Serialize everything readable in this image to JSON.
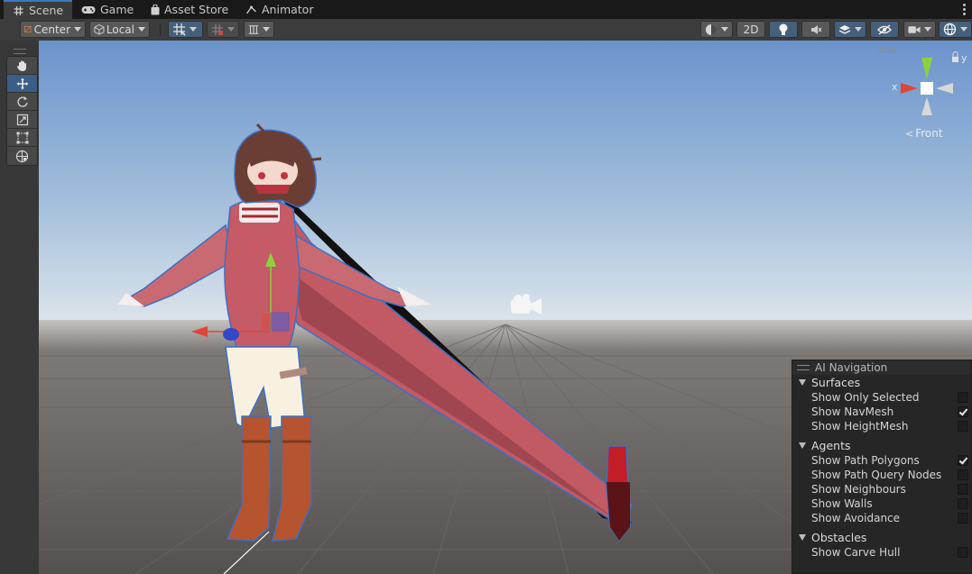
{
  "tabs": [
    {
      "label": "Scene",
      "icon": "grid-icon",
      "active": true
    },
    {
      "label": "Game",
      "icon": "gamepad-icon",
      "active": false
    },
    {
      "label": "Asset Store",
      "icon": "shopping-bag-icon",
      "active": false
    },
    {
      "label": "Animator",
      "icon": "animator-icon",
      "active": false
    }
  ],
  "toolbar": {
    "pivot_mode": "Center",
    "pivot_rotation": "Local",
    "mode_2d": "2D"
  },
  "gizmo": {
    "x_label": "x",
    "y_label": "y",
    "view_label": "Front"
  },
  "ai_navigation": {
    "title": "AI Navigation",
    "sections": [
      {
        "name": "Surfaces",
        "options": [
          {
            "label": "Show Only Selected",
            "checked": false
          },
          {
            "label": "Show NavMesh",
            "checked": true
          },
          {
            "label": "Show HeightMesh",
            "checked": false
          }
        ]
      },
      {
        "name": "Agents",
        "options": [
          {
            "label": "Show Path Polygons",
            "checked": true
          },
          {
            "label": "Show Path Query Nodes",
            "checked": false
          },
          {
            "label": "Show Neighbours",
            "checked": false
          },
          {
            "label": "Show Walls",
            "checked": false
          },
          {
            "label": "Show Avoidance",
            "checked": false
          }
        ]
      },
      {
        "name": "Obstacles",
        "options": [
          {
            "label": "Show Carve Hull",
            "checked": false
          }
        ]
      }
    ]
  },
  "colors": {
    "accent": "#3a79bb",
    "sky_top": "#6f98cf",
    "ground": "#5d5b5a",
    "gizmo_x": "#e0453a",
    "gizmo_y": "#8fd13d",
    "gizmo_z": "#3147c8"
  }
}
